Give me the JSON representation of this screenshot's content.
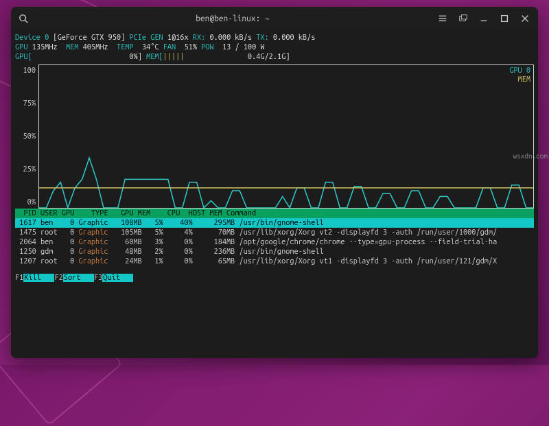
{
  "title": "ben@ben-linux: ~",
  "device": {
    "label": "Device 0",
    "name": "[GeForce GTX 950]",
    "pcie_label": "PCIe GEN",
    "pcie_val": "1@16x",
    "rx_label": "RX:",
    "rx_val": "0.000 kB/s",
    "tx_label": "TX:",
    "tx_val": "0.000 kB/s",
    "gpu_clk_label": "GPU",
    "gpu_clk": "135MHz",
    "mem_clk_label": "MEM",
    "mem_clk": "405MHz",
    "temp_label": "TEMP",
    "temp": "34°C",
    "fan_label": "FAN",
    "fan": "51%",
    "pow_label": "POW",
    "pow": "13 / 100 W",
    "gpu_bar_label": "GPU[",
    "gpu_bar_pct": "0%]",
    "mem_bar_label": "MEM[",
    "mem_bar_fill": "|||||",
    "mem_bar_val": "0.4G/2.1G]"
  },
  "chart_data": {
    "type": "line",
    "ylim": [
      0,
      100
    ],
    "ylabel": "",
    "title": "",
    "y_ticks": [
      "100",
      "75%",
      "50%",
      "25%",
      "0%"
    ],
    "legend": [
      "GPU 0",
      "MEM"
    ],
    "series": [
      {
        "name": "GPU 0",
        "color": "#2dc7c7",
        "values": [
          0,
          0,
          12,
          18,
          0,
          14,
          20,
          35,
          20,
          0,
          0,
          0,
          20,
          20,
          20,
          20,
          20,
          20,
          20,
          0,
          0,
          18,
          18,
          0,
          5,
          0,
          0,
          12,
          12,
          0,
          0,
          0,
          0,
          0,
          8,
          0,
          14,
          14,
          0,
          0,
          18,
          18,
          0,
          0,
          15,
          15,
          0,
          0,
          10,
          10,
          0,
          0,
          12,
          12,
          0,
          0,
          8,
          8,
          0,
          0,
          0,
          0,
          14,
          14,
          0,
          0,
          16,
          16,
          0,
          0
        ]
      },
      {
        "name": "MEM",
        "color": "#d0c060",
        "values": [
          14,
          14,
          14,
          14,
          14,
          14,
          14,
          14,
          14,
          14,
          14,
          14,
          14,
          14,
          14,
          14,
          14,
          14,
          14,
          14,
          14,
          14,
          14,
          14,
          14,
          14,
          14,
          14,
          14,
          14,
          14,
          14,
          14,
          14,
          14,
          14,
          14,
          14,
          14,
          14,
          14,
          14,
          14,
          14,
          14,
          14,
          14,
          14,
          14,
          14,
          14,
          14,
          14,
          14,
          14,
          14,
          14,
          14,
          14,
          14,
          14,
          14,
          14,
          14,
          14,
          14,
          14,
          14,
          14,
          14
        ]
      }
    ]
  },
  "table": {
    "headers": "  PID USER GPU    TYPE   GPU MEM    CPU  HOST MEM Command",
    "rows": [
      {
        "sel": true,
        "pid": " 1617",
        "user": "ben ",
        "gpu": "  0",
        "type": "Graphic",
        "gmem": "  108MB",
        "gm": "  5%",
        "cpu": "   40%",
        "hmem": "   295MB",
        "cmd": "/usr/bin/gnome-shell"
      },
      {
        "sel": false,
        "pid": " 1475",
        "user": "root",
        "gpu": "  0",
        "type": "Graphic",
        "gmem": "  105MB",
        "gm": "  5%",
        "cpu": "    4%",
        "hmem": "    70MB",
        "cmd": "/usr/lib/xorg/Xorg vt2 -displayfd 3 -auth /run/user/1000/gdm/"
      },
      {
        "sel": false,
        "pid": " 2064",
        "user": "ben ",
        "gpu": "  0",
        "type": "Graphic",
        "gmem": "   60MB",
        "gm": "  3%",
        "cpu": "    0%",
        "hmem": "   184MB",
        "cmd": "/opt/google/chrome/chrome --type=gpu-process --field-trial-ha"
      },
      {
        "sel": false,
        "pid": " 1250",
        "user": "gdm ",
        "gpu": "  0",
        "type": "Graphic",
        "gmem": "   48MB",
        "gm": "  2%",
        "cpu": "    0%",
        "hmem": "   236MB",
        "cmd": "/usr/bin/gnome-shell"
      },
      {
        "sel": false,
        "pid": " 1207",
        "user": "root",
        "gpu": "  0",
        "type": "Graphic",
        "gmem": "   24MB",
        "gm": "  1%",
        "cpu": "    0%",
        "hmem": "    65MB",
        "cmd": "/usr/lib/xorg/Xorg vt1 -displayfd 3 -auth /run/user/121/gdm/X"
      }
    ]
  },
  "footer": {
    "f1": "F1",
    "a1": "Kill   ",
    "f2": "F2",
    "a2": "Sort   ",
    "f3": "F3",
    "a3": "Quit   "
  },
  "watermark": "wsxdn.com"
}
